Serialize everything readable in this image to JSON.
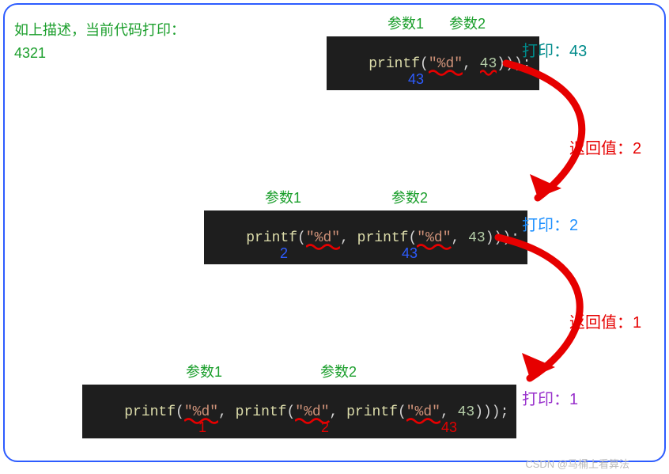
{
  "description": {
    "line1": "如上描述，当前代码打印：",
    "line2": "4321"
  },
  "labels": {
    "param1": "参数1",
    "param2": "参数2",
    "print_prefix": "打印：",
    "return_prefix": "返回值："
  },
  "step1": {
    "code": {
      "fn": "printf",
      "fmt": "\"%d\"",
      "arg": "43",
      "tail": ")));"
    },
    "below": "43",
    "print_value": "43",
    "return_value": "2"
  },
  "step2": {
    "code": {
      "fn": "printf",
      "fmt": "\"%d\"",
      "inner_fn": "printf",
      "inner_fmt": "\"%d\"",
      "inner_arg": "43",
      "tail": ")));"
    },
    "below": {
      "under_fmt": "2",
      "under_arg": "43"
    },
    "print_value": "2",
    "return_value": "1"
  },
  "step3": {
    "code": {
      "fn1": "printf",
      "fmt1": "\"%d\"",
      "fn2": "printf",
      "fmt2": "\"%d\"",
      "fn3": "printf",
      "fmt3": "\"%d\"",
      "arg": "43",
      "tail": ")));"
    },
    "below": {
      "v1": "1",
      "v2": "2",
      "v3": "43"
    },
    "print_value": "1"
  },
  "watermark": "CSDN @马桶上看算法",
  "colors": {
    "border": "#2d5cff",
    "param": "#1a9e2b",
    "return": "#e60000"
  }
}
